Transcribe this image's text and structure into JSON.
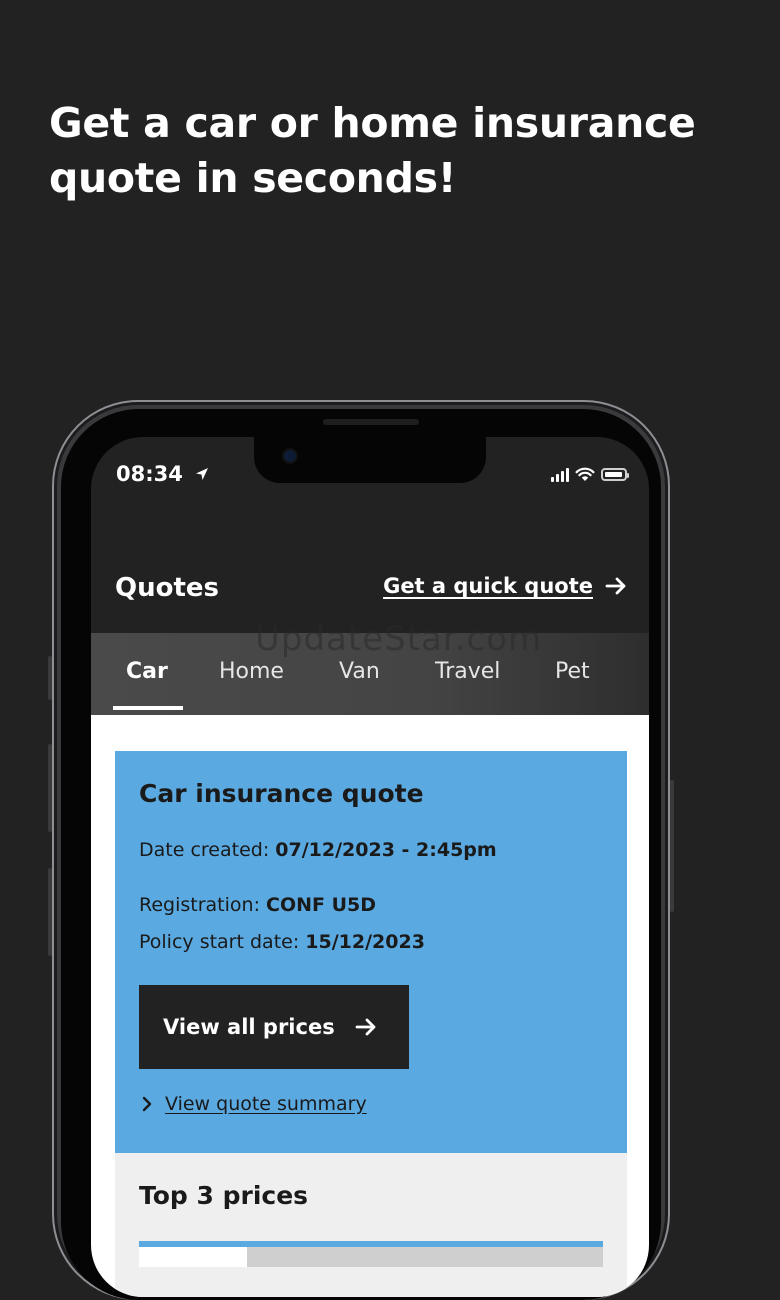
{
  "headline": "Get a car or home insurance quote in seconds!",
  "status_bar": {
    "time": "08:34"
  },
  "header": {
    "title": "Quotes",
    "quick_quote_label": "Get a quick quote"
  },
  "watermark": "UpdateStar.com",
  "tabs": [
    {
      "label": "Car",
      "active": true
    },
    {
      "label": "Home"
    },
    {
      "label": "Van"
    },
    {
      "label": "Travel"
    },
    {
      "label": "Pet"
    }
  ],
  "quote_card": {
    "title": "Car insurance quote",
    "date_created_label": "Date created:",
    "date_created_value": "07/12/2023 - 2:45pm",
    "registration_label": "Registration:",
    "registration_value": "CONF U5D",
    "policy_start_label": "Policy start date:",
    "policy_start_value": "15/12/2023",
    "view_prices_label": "View all prices",
    "view_summary_label": "View quote summary"
  },
  "prices_section": {
    "title": "Top 3 prices"
  },
  "colors": {
    "background": "#222222",
    "card_blue": "#5aa9e1",
    "prices_bg": "#efefef"
  }
}
